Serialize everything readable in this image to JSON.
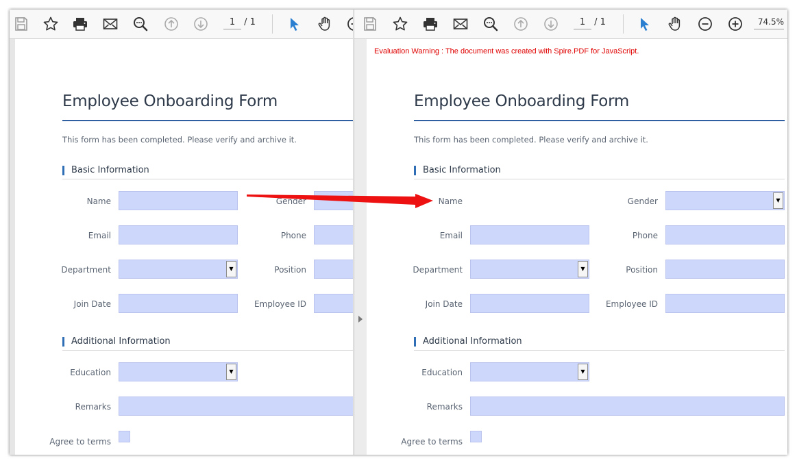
{
  "toolbar": {
    "icons": [
      "save-icon",
      "star-icon",
      "print-icon",
      "mail-icon",
      "search-icon",
      "up-arrow-icon",
      "down-arrow-icon",
      "select-cursor-icon",
      "hand-pan-icon",
      "zoom-out-icon",
      "zoom-in-icon"
    ],
    "page_current": "1",
    "page_total": "/ 1",
    "zoom": "74.5%"
  },
  "warning": "Evaluation Warning : The document was created with Spire.PDF for JavaScript.",
  "form": {
    "title": "Employee Onboarding Form",
    "description": "This form has been completed. Please verify and archive it.",
    "section_basic": "Basic Information",
    "section_additional": "Additional Information",
    "labels": {
      "name": "Name",
      "gender": "Gender",
      "email": "Email",
      "phone": "Phone",
      "department": "Department",
      "position": "Position",
      "join_date": "Join Date",
      "employee_id": "Employee ID",
      "education": "Education",
      "remarks": "Remarks",
      "agree": "Agree to terms"
    }
  },
  "colors": {
    "field_fill": "#cdd6fb",
    "accent": "#2f6db5",
    "warning": "#e00000",
    "annotation_arrow": "#ee1111"
  }
}
